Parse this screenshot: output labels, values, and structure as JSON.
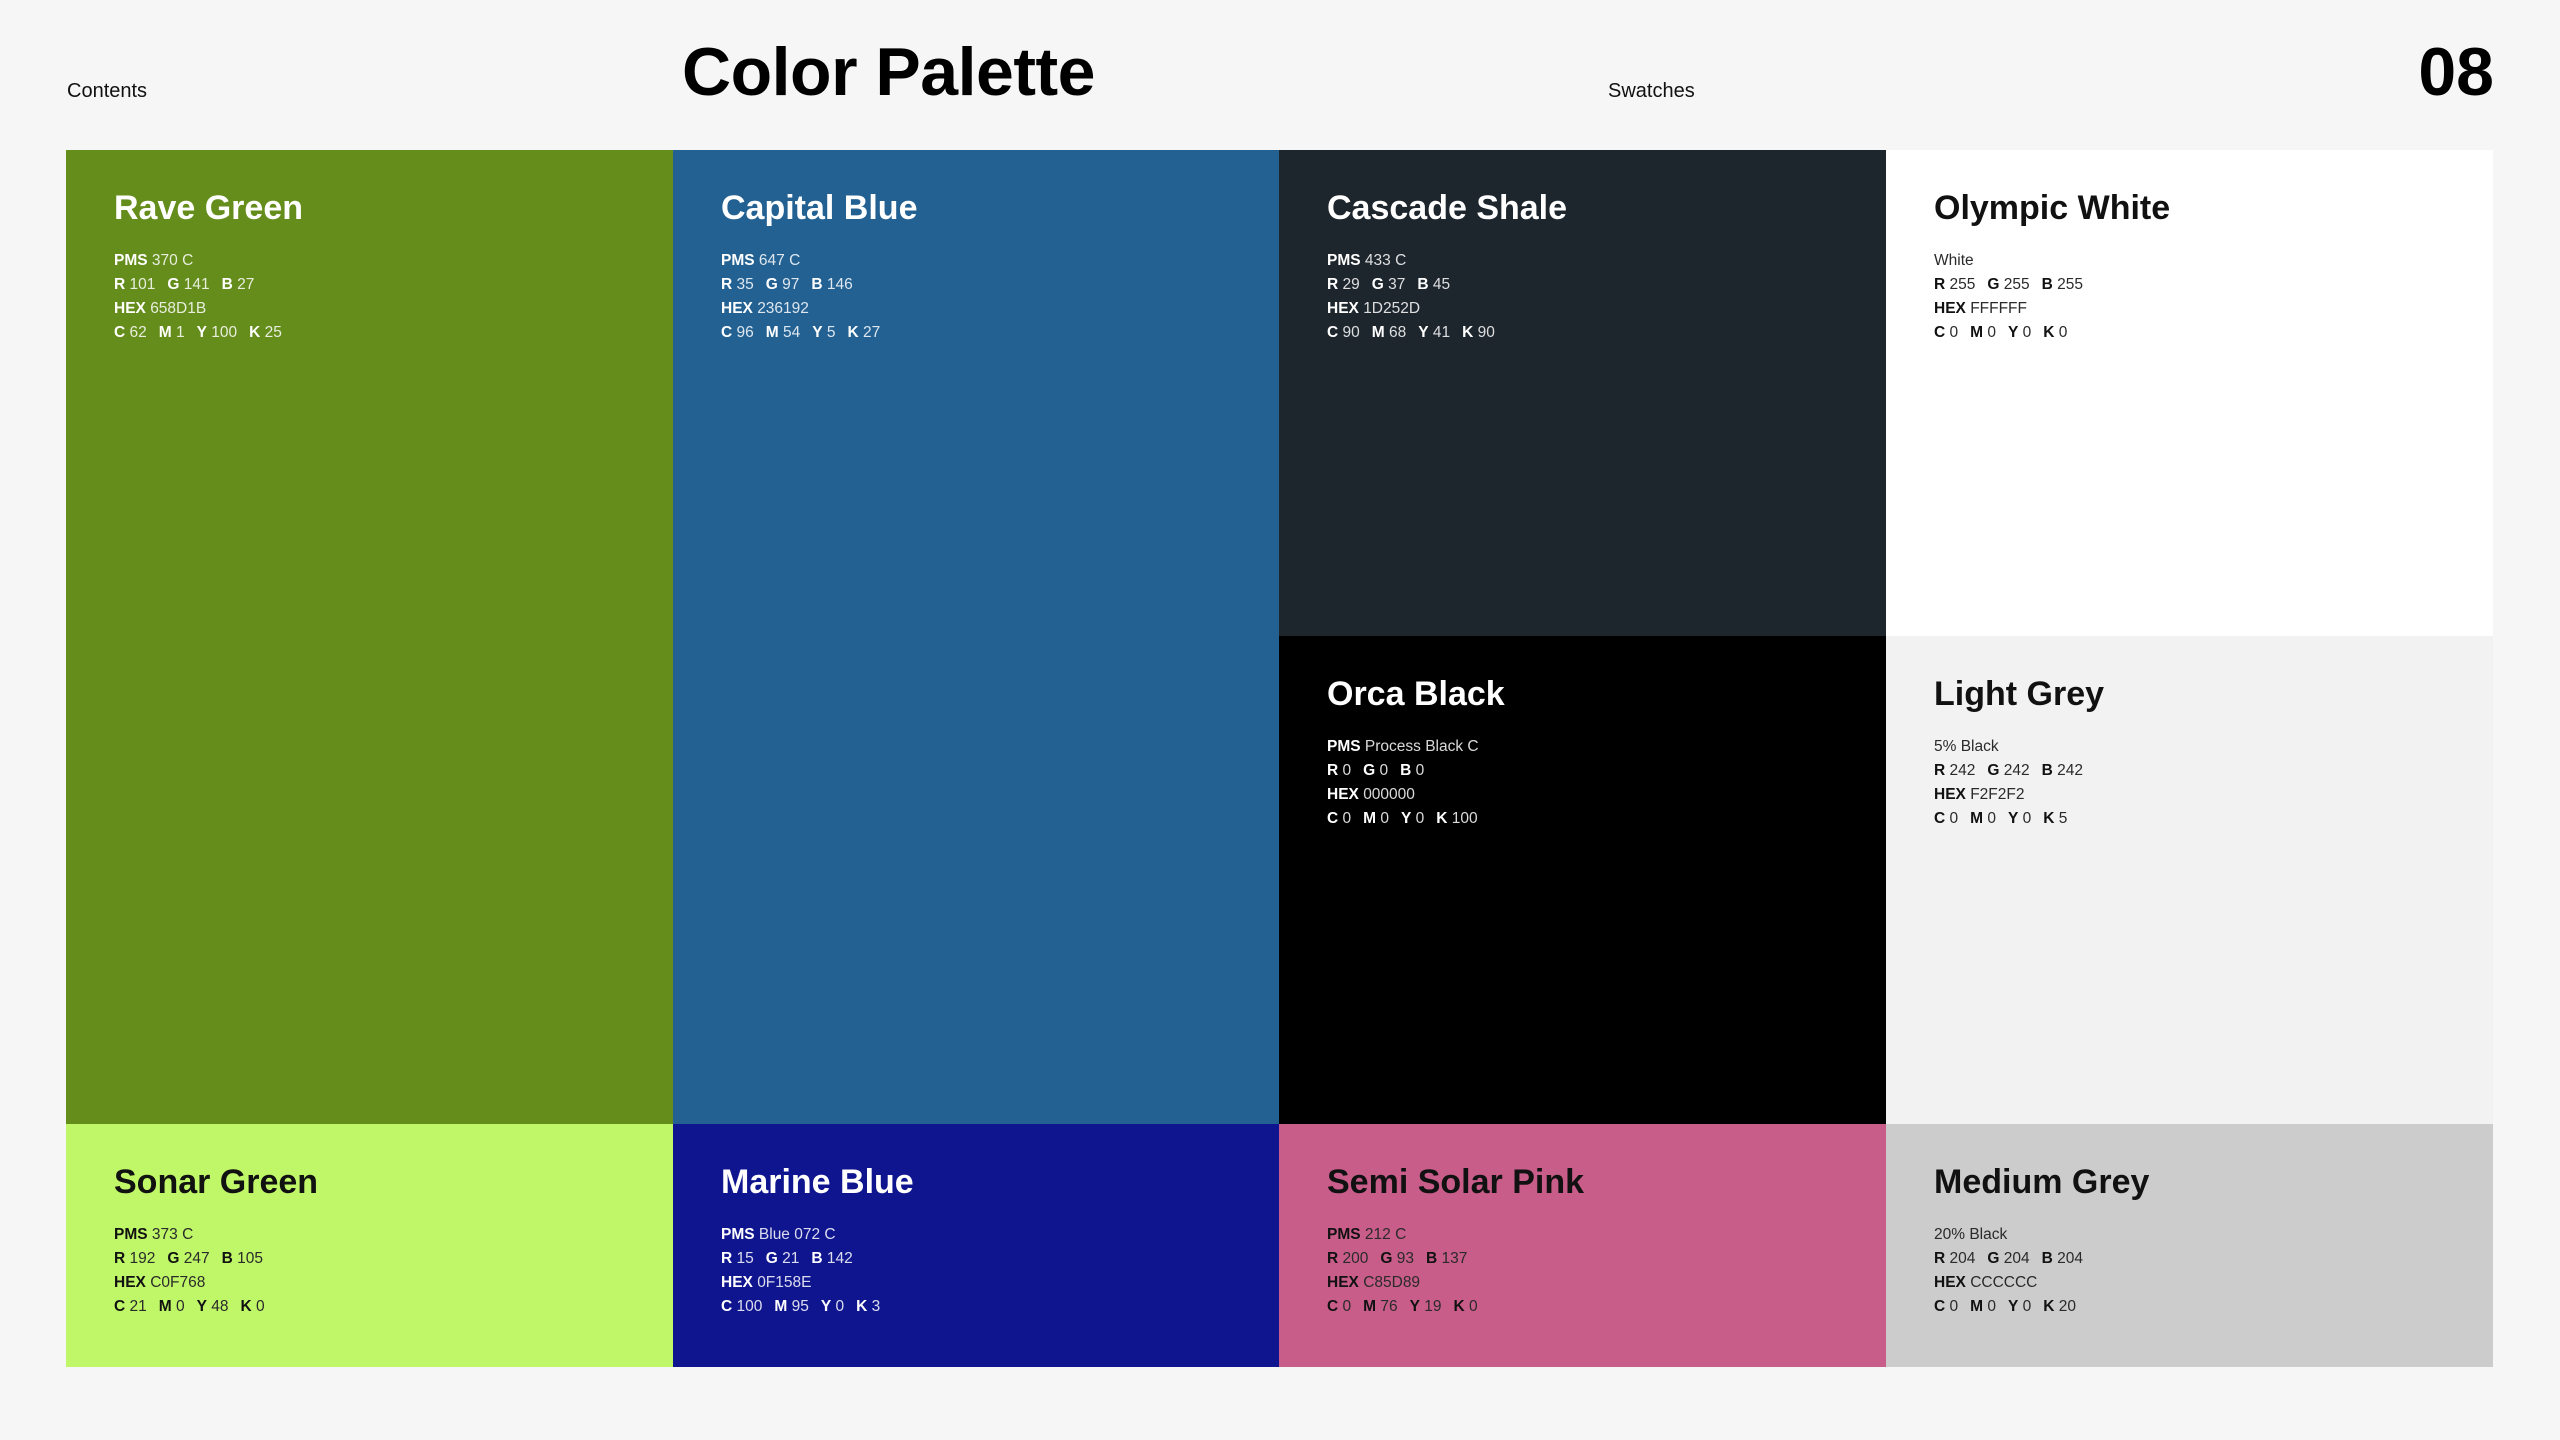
{
  "header": {
    "contents_label": "Contents",
    "title": "Color Palette",
    "swatches_label": "Swatches",
    "page_number": "08"
  },
  "swatches": [
    {
      "name": "Rave Green",
      "bg": "#658D1B",
      "text_color": "light",
      "line1": {
        "label": "PMS",
        "value": "370 C"
      },
      "rgb": {
        "r": "101",
        "g": "141",
        "b": "27"
      },
      "hex": "658D1B",
      "cmyk": {
        "c": "62",
        "m": "1",
        "y": "100",
        "k": "25"
      }
    },
    {
      "name": "Capital Blue",
      "bg": "#236192",
      "text_color": "light",
      "line1": {
        "label": "PMS",
        "value": "647 C"
      },
      "rgb": {
        "r": "35",
        "g": "97",
        "b": "146"
      },
      "hex": "236192",
      "cmyk": {
        "c": "96",
        "m": "54",
        "y": "5",
        "k": "27"
      }
    },
    {
      "name": "Cascade Shale",
      "bg": "#1D252D",
      "text_color": "light",
      "line1": {
        "label": "PMS",
        "value": "433 C"
      },
      "rgb": {
        "r": "29",
        "g": "37",
        "b": "45"
      },
      "hex": "1D252D",
      "cmyk": {
        "c": "90",
        "m": "68",
        "y": "41",
        "k": "90"
      }
    },
    {
      "name": "Olympic White",
      "bg": "#FFFFFF",
      "text_color": "dark",
      "line1": {
        "label": "",
        "value": "White"
      },
      "rgb": {
        "r": "255",
        "g": "255",
        "b": "255"
      },
      "hex": "FFFFFF",
      "cmyk": {
        "c": "0",
        "m": "0",
        "y": "0",
        "k": "0"
      }
    },
    {
      "name": "Orca Black",
      "bg": "#000000",
      "text_color": "light",
      "line1": {
        "label": "PMS",
        "value": "Process Black C"
      },
      "rgb": {
        "r": "0",
        "g": "0",
        "b": "0"
      },
      "hex": "000000",
      "cmyk": {
        "c": "0",
        "m": "0",
        "y": "0",
        "k": "100"
      }
    },
    {
      "name": "Light Grey",
      "bg": "#F2F2F2",
      "text_color": "dark",
      "line1": {
        "label": "",
        "value": "5% Black"
      },
      "rgb": {
        "r": "242",
        "g": "242",
        "b": "242"
      },
      "hex": "F2F2F2",
      "cmyk": {
        "c": "0",
        "m": "0",
        "y": "0",
        "k": "5"
      }
    },
    {
      "name": "Sonar Green",
      "bg": "#C0F768",
      "text_color": "dark",
      "line1": {
        "label": "PMS",
        "value": "373 C"
      },
      "rgb": {
        "r": "192",
        "g": "247",
        "b": "105"
      },
      "hex": "C0F768",
      "cmyk": {
        "c": "21",
        "m": "0",
        "y": "48",
        "k": "0"
      }
    },
    {
      "name": "Marine Blue",
      "bg": "#0F158E",
      "text_color": "light",
      "line1": {
        "label": "PMS",
        "value": "Blue 072 C"
      },
      "rgb": {
        "r": "15",
        "g": "21",
        "b": "142"
      },
      "hex": "0F158E",
      "cmyk": {
        "c": "100",
        "m": "95",
        "y": "0",
        "k": "3"
      }
    },
    {
      "name": "Semi Solar Pink",
      "bg": "#C85D89",
      "text_color": "dark",
      "line1": {
        "label": "PMS",
        "value": "212 C"
      },
      "rgb": {
        "r": "200",
        "g": "93",
        "b": "137"
      },
      "hex": "C85D89",
      "cmyk": {
        "c": "0",
        "m": "76",
        "y": "19",
        "k": "0"
      }
    },
    {
      "name": "Medium Grey",
      "bg": "#CCCCCC",
      "text_color": "dark",
      "line1": {
        "label": "",
        "value": "20% Black"
      },
      "rgb": {
        "r": "204",
        "g": "204",
        "b": "204"
      },
      "hex": "CCCCCC",
      "cmyk": {
        "c": "0",
        "m": "0",
        "y": "0",
        "k": "20"
      }
    }
  ]
}
